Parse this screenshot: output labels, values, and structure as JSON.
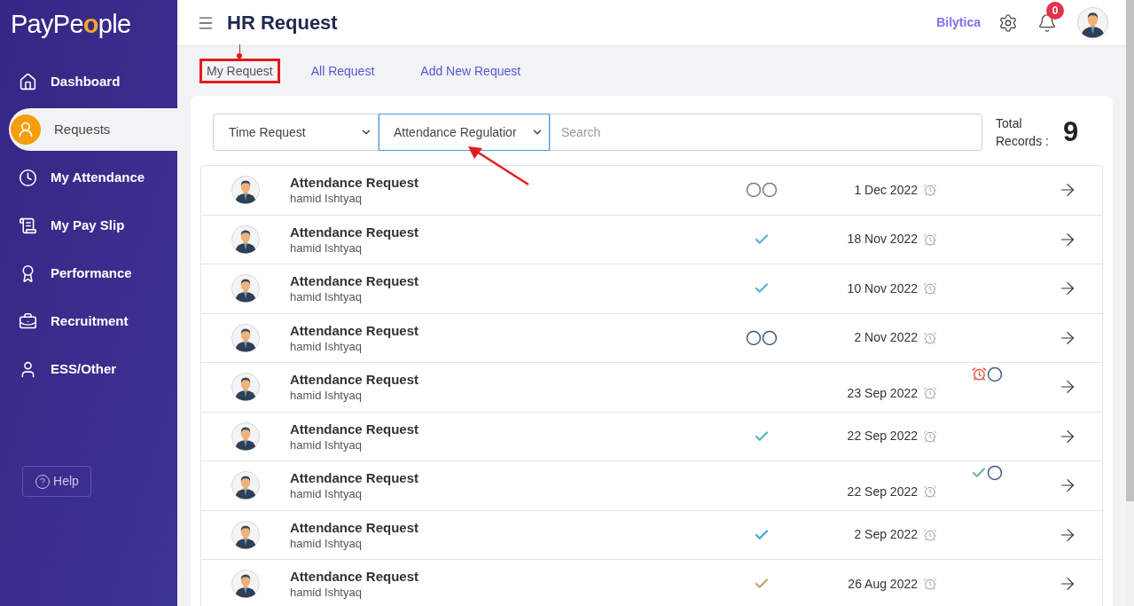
{
  "logo": [
    {
      "text": "PayPe",
      "accent": false
    },
    {
      "text": "o",
      "accent": true
    },
    {
      "text": "ple",
      "accent": false
    }
  ],
  "sidebar": {
    "items": [
      {
        "label": "Dashboard",
        "selected": false
      },
      {
        "label": "Requests",
        "selected": true
      },
      {
        "label": "My Attendance",
        "selected": false
      },
      {
        "label": "My Pay Slip",
        "selected": false
      },
      {
        "label": "Performance",
        "selected": false
      },
      {
        "label": "Recruitment",
        "selected": false
      },
      {
        "label": "ESS/Other",
        "selected": false
      }
    ],
    "help": "Help"
  },
  "header": {
    "title": "HR Request",
    "company": "Bilytica",
    "notification_count": "0"
  },
  "tabs": [
    {
      "label": "My Request",
      "selected": true,
      "highlighted": true
    },
    {
      "label": "All Request",
      "selected": false,
      "highlighted": false
    },
    {
      "label": "Add New Request",
      "selected": false,
      "highlighted": false
    }
  ],
  "filters": {
    "type_select": {
      "value": "Time Request",
      "highlighted": false
    },
    "category_select": {
      "value": "Attendance Regulatior",
      "highlighted": true
    },
    "search": {
      "placeholder": "Search"
    }
  },
  "total": {
    "label": "Total Records :",
    "value": "9"
  },
  "rows": [
    {
      "title": "Attendance Request",
      "name": "hamid Ishtyaq",
      "date": "1 Dec 2022",
      "kind": "inline",
      "marks": [
        {
          "kind": "circle",
          "color": "#7a7a7a"
        },
        {
          "kind": "circle",
          "color": "#7a7a7a"
        }
      ]
    },
    {
      "title": "Attendance Request",
      "name": "hamid Ishtyaq",
      "date": "18 Nov 2022",
      "kind": "inline",
      "marks": [
        {
          "kind": "check",
          "color": "#5bb3c9"
        }
      ]
    },
    {
      "title": "Attendance Request",
      "name": "hamid Ishtyaq",
      "date": "10 Nov 2022",
      "kind": "inline",
      "marks": [
        {
          "kind": "check",
          "color": "#5bb3c9"
        }
      ]
    },
    {
      "title": "Attendance Request",
      "name": "hamid Ishtyaq",
      "date": "2 Nov 2022",
      "kind": "inline",
      "marks": [
        {
          "kind": "circle",
          "color": "#3d5a80"
        },
        {
          "kind": "circle",
          "color": "#3d5a80"
        }
      ]
    },
    {
      "title": "Attendance Request",
      "name": "hamid Ishtyaq",
      "date": "23 Sep 2022",
      "kind": "stacked",
      "marks": [
        {
          "kind": "clock",
          "color": "#e5533d"
        },
        {
          "kind": "circle",
          "color": "#3d5a80"
        }
      ]
    },
    {
      "title": "Attendance Request",
      "name": "hamid Ishtyaq",
      "date": "22 Sep 2022",
      "kind": "inline",
      "marks": [
        {
          "kind": "check",
          "color": "#5bb3c9"
        }
      ]
    },
    {
      "title": "Attendance Request",
      "name": "hamid Ishtyaq",
      "date": "22 Sep 2022",
      "kind": "stacked",
      "marks": [
        {
          "kind": "check",
          "color": "#6fb8a8"
        },
        {
          "kind": "circle",
          "color": "#3d5a80"
        }
      ]
    },
    {
      "title": "Attendance Request",
      "name": "hamid Ishtyaq",
      "date": "2 Sep 2022",
      "kind": "inline",
      "marks": [
        {
          "kind": "check",
          "color": "#4aa3d8"
        }
      ]
    },
    {
      "title": "Attendance Request",
      "name": "hamid Ishtyaq",
      "date": "26 Aug 2022",
      "kind": "inline",
      "marks": [
        {
          "kind": "check",
          "color": "#c9a26a"
        }
      ]
    }
  ]
}
